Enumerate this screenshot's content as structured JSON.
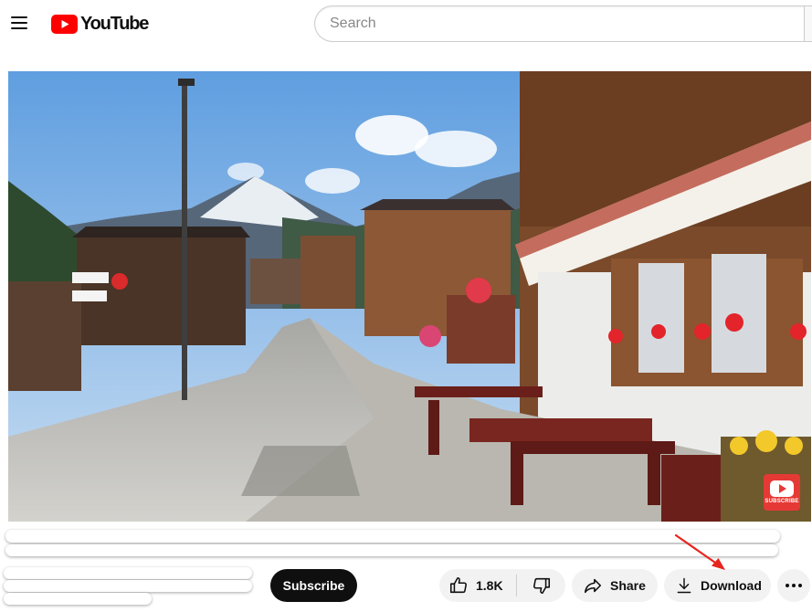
{
  "header": {
    "logo_text": "YouTube",
    "search_placeholder": "Search"
  },
  "video": {
    "watermark_text": "SUBSCRIBE"
  },
  "actions": {
    "subscribe_label": "Subscribe",
    "like_count": "1.8K",
    "share_label": "Share",
    "download_label": "Download"
  },
  "colors": {
    "brand_red": "#ff0000",
    "annotation_red": "#e8251c",
    "subscribe_bg": "#0f0f0f",
    "pill_bg": "#f2f2f2"
  },
  "icons": [
    "menu-icon",
    "youtube-logo-icon",
    "like-icon",
    "dislike-icon",
    "share-icon",
    "download-icon",
    "more-icon"
  ]
}
